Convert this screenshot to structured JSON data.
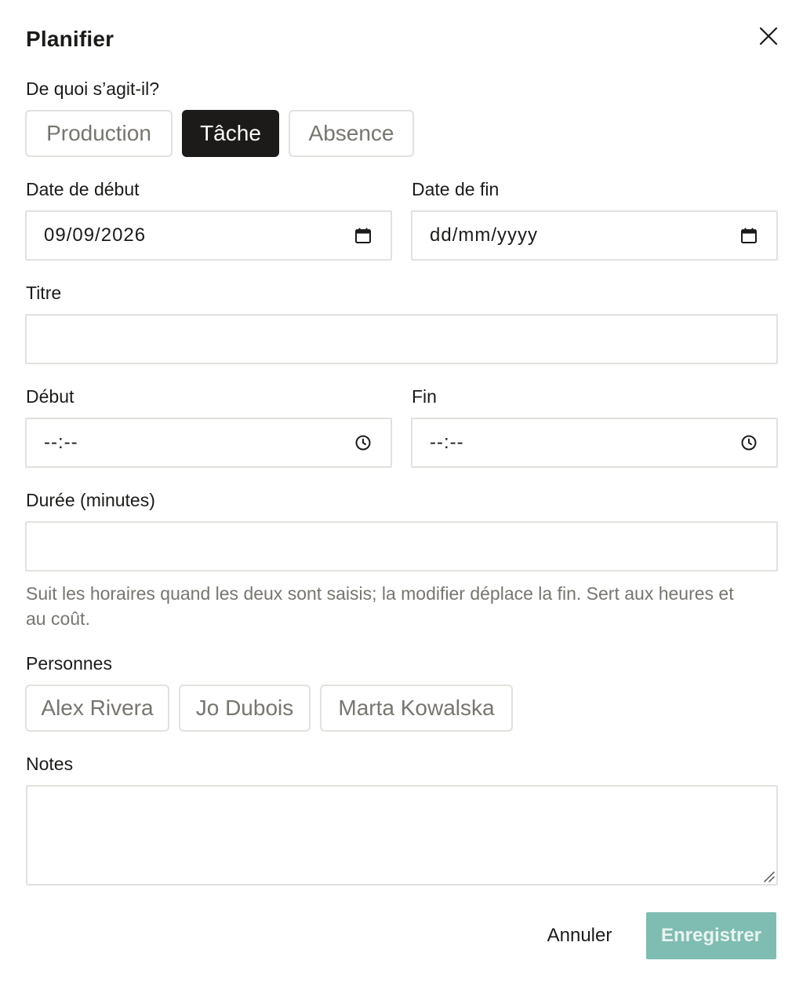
{
  "dialog": {
    "title": "Planifier",
    "close_icon": "close-icon"
  },
  "type_selector": {
    "label": "De quoi s’agit-il?",
    "options": [
      {
        "label": "Production",
        "selected": false
      },
      {
        "label": "Tâche",
        "selected": true
      },
      {
        "label": "Absence",
        "selected": false
      }
    ]
  },
  "dates": {
    "start_label": "Date de début",
    "start_value": "09/09/2026",
    "end_label": "Date de fin",
    "end_placeholder": "dd/mm/yyyy",
    "icon": "calendar-icon"
  },
  "title_field": {
    "label": "Titre",
    "value": ""
  },
  "times": {
    "start_label": "Début",
    "start_placeholder": "--:--",
    "end_label": "Fin",
    "end_placeholder": "--:--",
    "icon": "clock-icon"
  },
  "duration": {
    "label": "Durée (minutes)",
    "value": "",
    "help": "Suit les horaires quand les deux sont saisis; la modifier déplace la fin. Sert aux heures et au coût."
  },
  "people": {
    "label": "Personnes",
    "items": [
      "Alex Rivera",
      "Jo Dubois",
      "Marta Kowalska"
    ]
  },
  "notes": {
    "label": "Notes",
    "value": ""
  },
  "actions": {
    "cancel_label": "Annuler",
    "save_label": "Enregistrer"
  },
  "colors": {
    "accent": "#7fbdb2",
    "selected": "#1c1b19",
    "border": "#e2e1dd",
    "muted_text": "#77756f"
  }
}
